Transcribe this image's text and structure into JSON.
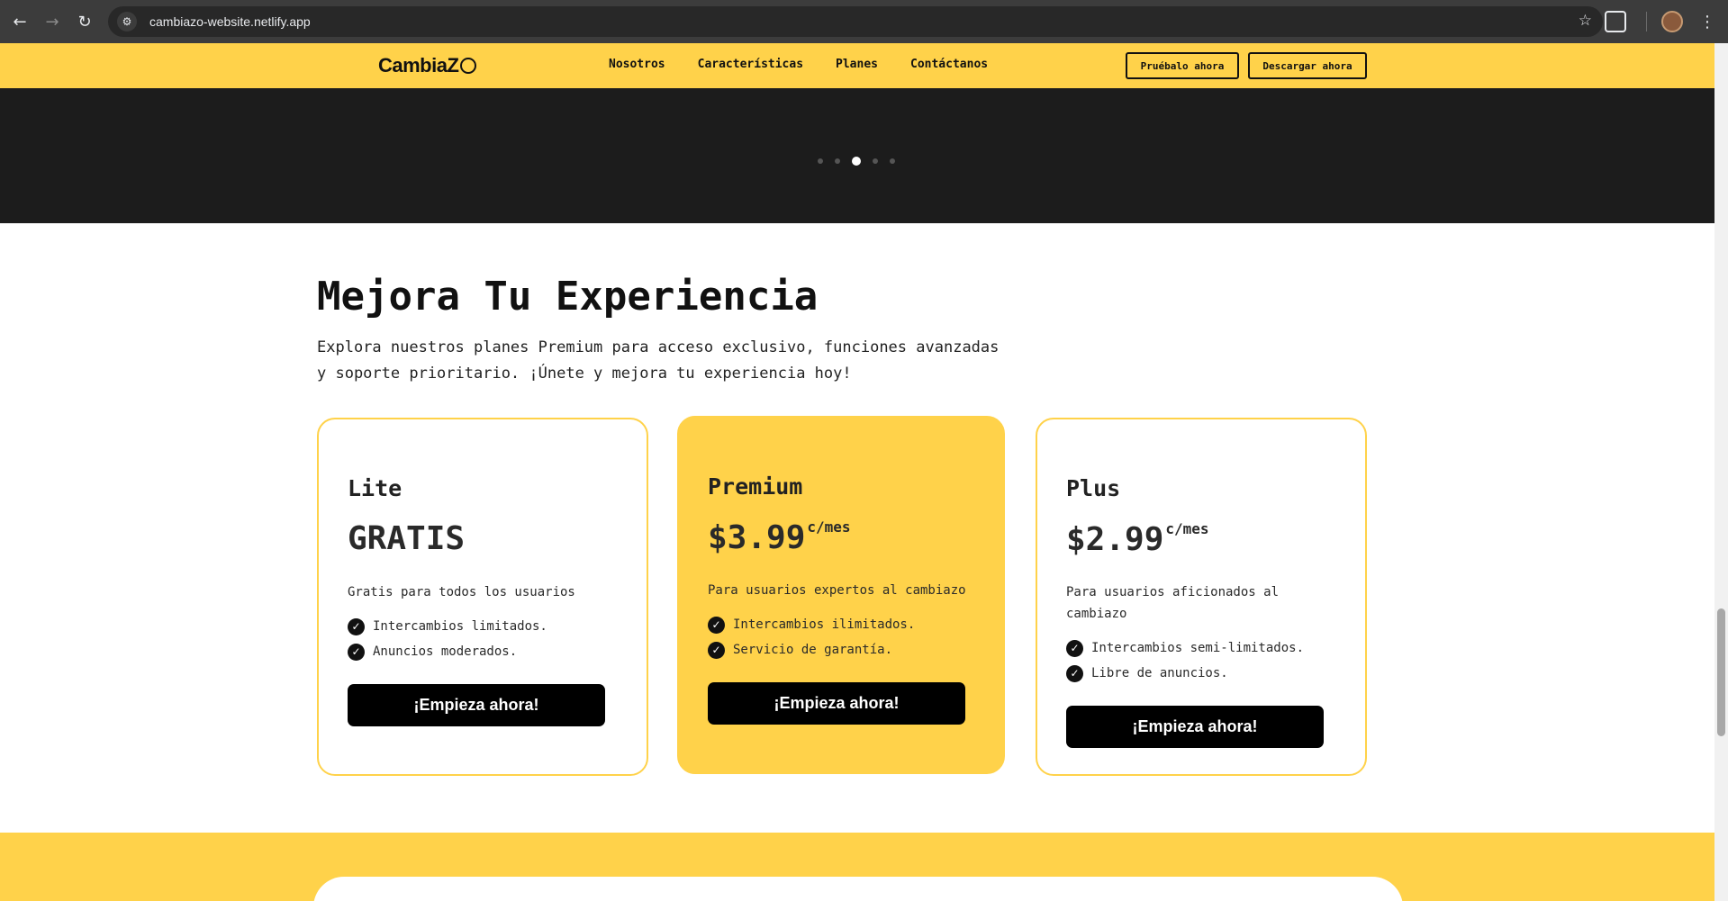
{
  "browser": {
    "url": "cambiazo-website.netlify.app",
    "back_icon": "back-arrow-icon",
    "forward_icon": "forward-arrow-icon",
    "reload_icon": "reload-icon"
  },
  "header": {
    "logo_text": "CambiaZ",
    "nav": [
      "Nosotros",
      "Características",
      "Planes",
      "Contáctanos"
    ],
    "try_label": "Pruébalo ahora",
    "download_label": "Descargar ahora"
  },
  "carousel": {
    "dot_count": 5,
    "active_index": 2
  },
  "pricing": {
    "title": "Mejora Tu Experiencia",
    "description_line1": "Explora nuestros planes Premium para acceso exclusivo, funciones avanzadas",
    "description_line2": "y soporte prioritario. ¡Únete y mejora tu experiencia hoy!",
    "plans": [
      {
        "name": "Lite",
        "price": "GRATIS",
        "period": "",
        "subtitle": "Gratis para todos los usuarios",
        "features": [
          "Intercambios limitados.",
          "Anuncios moderados."
        ],
        "cta": "¡Empieza ahora!"
      },
      {
        "name": "Premium",
        "price": "$3.99",
        "period": "c/mes",
        "subtitle": "Para usuarios expertos al cambiazo",
        "features": [
          "Intercambios ilimitados.",
          "Servicio de garantía."
        ],
        "cta": "¡Empieza ahora!"
      },
      {
        "name": "Plus",
        "price": "$2.99",
        "period": "c/mes",
        "subtitle": "Para usuarios aficionados al cambiazo",
        "features": [
          "Intercambios semi-limitados.",
          "Libre de anuncios."
        ],
        "cta": "¡Empieza ahora!"
      }
    ]
  },
  "colors": {
    "brand_yellow": "#ffd24a",
    "dark": "#1c1c1c",
    "black": "#000000"
  }
}
